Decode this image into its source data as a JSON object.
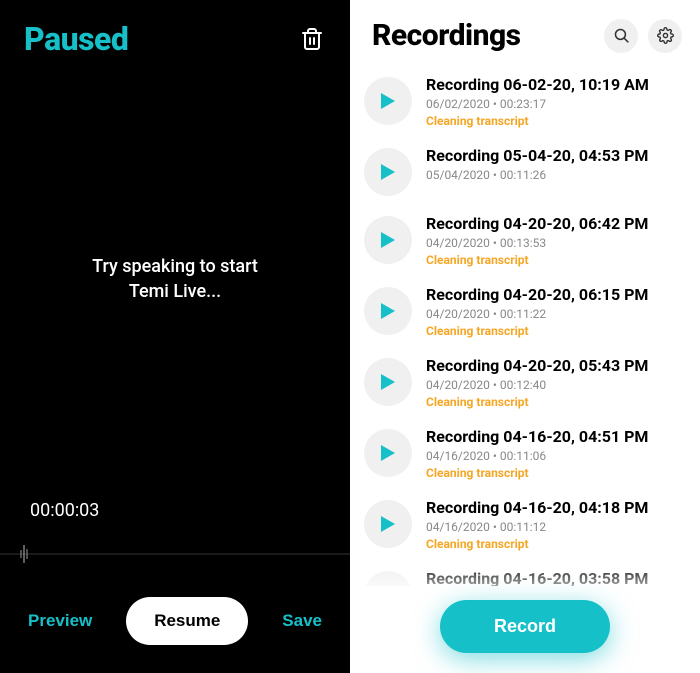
{
  "left": {
    "title": "Paused",
    "prompt": "Try speaking to start\nTemi Live...",
    "timer": "00:00:03",
    "preview_label": "Preview",
    "resume_label": "Resume",
    "save_label": "Save"
  },
  "right": {
    "title": "Recordings",
    "record_label": "Record",
    "status_cleaning": "Cleaning transcript",
    "items": [
      {
        "title": "Recording 06-02-20, 10:19 AM",
        "meta": "06/02/2020 • 00:23:17",
        "show_status": true
      },
      {
        "title": "Recording 05-04-20, 04:53 PM",
        "meta": "05/04/2020 • 00:11:26",
        "show_status": false
      },
      {
        "title": "Recording 04-20-20, 06:42 PM",
        "meta": "04/20/2020 • 00:13:53",
        "show_status": true
      },
      {
        "title": "Recording 04-20-20, 06:15 PM",
        "meta": "04/20/2020 • 00:11:22",
        "show_status": true
      },
      {
        "title": "Recording 04-20-20, 05:43 PM",
        "meta": "04/20/2020 • 00:12:40",
        "show_status": true
      },
      {
        "title": "Recording 04-16-20, 04:51 PM",
        "meta": "04/16/2020 • 00:11:06",
        "show_status": true
      },
      {
        "title": "Recording 04-16-20, 04:18 PM",
        "meta": "04/16/2020 • 00:11:12",
        "show_status": true
      },
      {
        "title": "Recording 04-16-20, 03:58 PM",
        "meta": "",
        "show_status": false
      }
    ]
  },
  "colors": {
    "accent": "#16c0c8",
    "warning": "#f5a623"
  }
}
